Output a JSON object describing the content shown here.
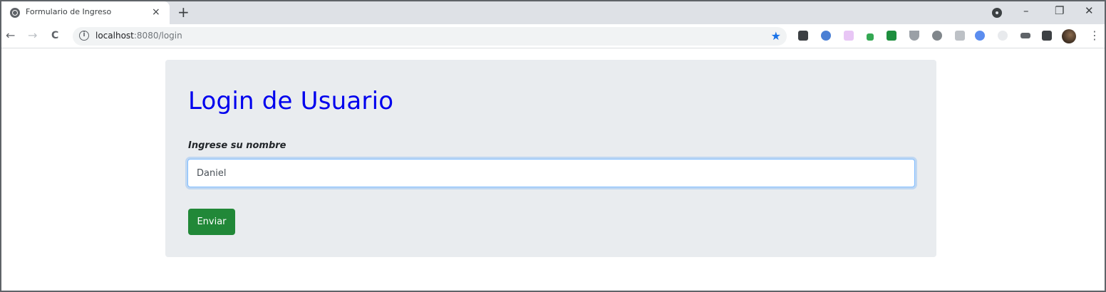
{
  "browser": {
    "tab_title": "Formulario de Ingreso",
    "tab_close": "×",
    "new_tab": "+",
    "url_host": "localhost",
    "url_rest": ":8080/login",
    "window_controls": {
      "minimize": "–",
      "restore": "❐",
      "close": "✕"
    },
    "nav": {
      "back": "←",
      "forward": "→",
      "reload": "C"
    },
    "menu": "⋮",
    "star": "★",
    "accent_color": "#1a73e8"
  },
  "form": {
    "heading": "Login de Usuario",
    "name_label": "Ingrese su nombre",
    "name_value": "Daniel",
    "submit_label": "Enviar",
    "heading_color": "#0000ee",
    "button_color": "#218838"
  }
}
